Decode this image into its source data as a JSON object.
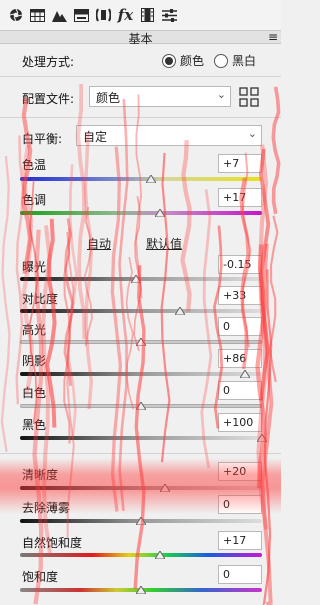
{
  "toolbar": {
    "icons": [
      "aperture-icon",
      "grid-table-icon",
      "mountains-icon",
      "split-tone-icon",
      "lens-icon",
      "fx-icon",
      "film-icon",
      "sliders-icon"
    ],
    "fx_label": "fx"
  },
  "panel": {
    "title": "基本",
    "menu_glyph": "≡"
  },
  "treatment": {
    "label": "处理方式:",
    "options": [
      "颜色",
      "黑白"
    ],
    "selected": "颜色"
  },
  "profile": {
    "label": "配置文件:",
    "value": "颜色"
  },
  "white_balance": {
    "label": "白平衡:",
    "value": "自定"
  },
  "sliders_wb": [
    {
      "id": "temp",
      "label": "色温",
      "value": "+7",
      "level": 0.54
    },
    {
      "id": "tint",
      "label": "色调",
      "value": "+17",
      "level": 0.58
    }
  ],
  "auto_label": "自动",
  "default_label": "默认值",
  "sliders_tone": [
    {
      "id": "exposure",
      "label": "曝光",
      "value": "-0.15",
      "level": 0.48
    },
    {
      "id": "contrast",
      "label": "对比度",
      "value": "+33",
      "level": 0.66
    },
    {
      "id": "highlights",
      "label": "高光",
      "value": "0",
      "level": 0.5
    },
    {
      "id": "shadows",
      "label": "阴影",
      "value": "+86",
      "level": 0.93
    },
    {
      "id": "whites",
      "label": "白色",
      "value": "0",
      "level": 0.5
    },
    {
      "id": "blacks",
      "label": "黑色",
      "value": "+100",
      "level": 1.0
    }
  ],
  "sliders_presence": [
    {
      "id": "clarity",
      "label": "清晰度",
      "value": "+20",
      "level": 0.6
    },
    {
      "id": "dehaze",
      "label": "去除薄雾",
      "value": "0",
      "level": 0.5
    },
    {
      "id": "vibrance",
      "label": "自然饱和度",
      "value": "+17",
      "level": 0.58
    },
    {
      "id": "saturation",
      "label": "饱和度",
      "value": "0",
      "level": 0.5
    }
  ],
  "colors": {
    "overlay_red": "#ff3c3c"
  }
}
